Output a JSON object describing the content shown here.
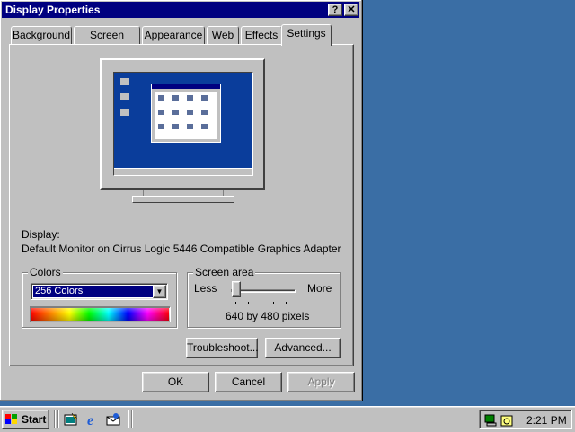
{
  "window": {
    "title": "Display Properties",
    "help_glyph": "?",
    "close_glyph": "✕"
  },
  "tabs": [
    {
      "label": "Background"
    },
    {
      "label": "Screen Saver"
    },
    {
      "label": "Appearance"
    },
    {
      "label": "Web"
    },
    {
      "label": "Effects"
    },
    {
      "label": "Settings",
      "active": true
    }
  ],
  "display": {
    "label": "Display:",
    "device": "Default Monitor on Cirrus Logic 5446 Compatible Graphics Adapter"
  },
  "colors": {
    "legend": "Colors",
    "selected": "256 Colors",
    "arrow": "▼"
  },
  "screen_area": {
    "legend": "Screen area",
    "less": "Less",
    "more": "More",
    "value": "640 by 480 pixels",
    "slider_position": 0
  },
  "buttons": {
    "troubleshoot": "Troubleshoot...",
    "advanced": "Advanced...",
    "ok": "OK",
    "cancel": "Cancel",
    "apply": "Apply"
  },
  "taskbar": {
    "start_label": "Start",
    "clock": "2:21 PM"
  },
  "colors_theme": {
    "desktop": "#3a6ea5",
    "titlebar": "#000080",
    "face": "#c0c0c0"
  }
}
